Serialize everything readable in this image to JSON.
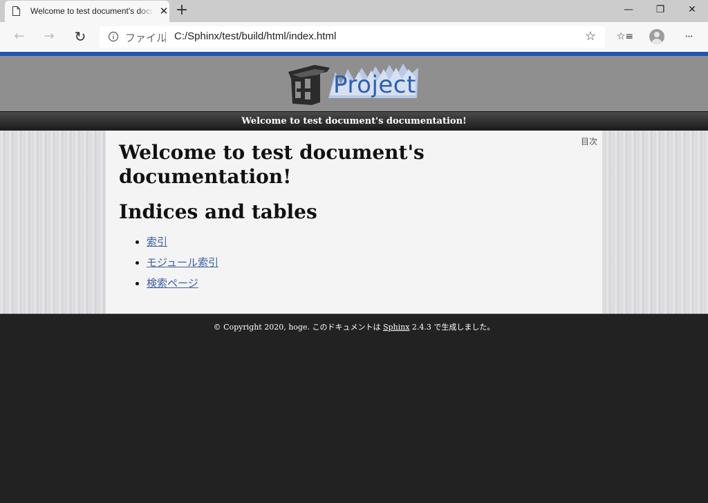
{
  "browser": {
    "tab_title": "Welcome to test document's documentation!",
    "new_tab": "+",
    "window": {
      "minimize": "—",
      "restore": "❐",
      "close": "✕"
    },
    "address": {
      "file_label": "ファイル",
      "url": "C:/Sphinx/test/build/html/index.html"
    },
    "icons": {
      "back": "←",
      "forward": "→",
      "refresh": "↻",
      "favorite": "☆",
      "favorites_list": "☆≡",
      "more": "···"
    }
  },
  "header": {
    "logo_text": "Project"
  },
  "relbar": {
    "title": "Welcome to test document's documentation!"
  },
  "document": {
    "toc_label": "目次",
    "title": "Welcome to test document's documentation!",
    "section_title": "Indices and tables",
    "links": [
      "索引",
      "モジュール索引",
      "検索ページ"
    ]
  },
  "footer": {
    "prefix": "© Copyright 2020, hoge. このドキュメントは ",
    "sphinx_link": "Sphinx",
    "suffix": " 2.4.3 で生成しました。"
  },
  "colors": {
    "accent_bar": "#1e56b4",
    "logo_text": "#2860b4",
    "link": "#3a5ea8",
    "footer_bg": "#222222",
    "header_bg": "#8f8f8f"
  }
}
